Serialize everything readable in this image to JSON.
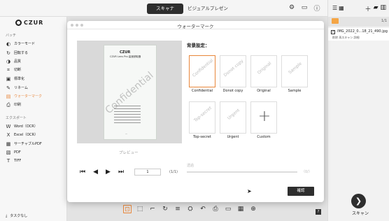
{
  "topbar": {
    "mode_tabs": [
      "スキャナ",
      "ビジュアルプレゼン"
    ],
    "icons": [
      "settings-icon",
      "feedback-icon",
      "help-icon"
    ]
  },
  "sidebar": {
    "brand": "CZUR",
    "batch_title": "バッチ",
    "batch_items": [
      {
        "label": "カラーモード",
        "icon": "color-mode-icon"
      },
      {
        "label": "回転する",
        "icon": "rotate-icon"
      },
      {
        "label": "品質",
        "icon": "quality-icon"
      },
      {
        "label": "切断",
        "icon": "cut-icon"
      },
      {
        "label": "標準化",
        "icon": "standardize-icon"
      },
      {
        "label": "リネーム",
        "icon": "rename-icon"
      },
      {
        "label": "ウォーターマーク",
        "icon": "watermark-icon",
        "active": true
      },
      {
        "label": "印刷",
        "icon": "print-icon"
      }
    ],
    "export_title": "エクスポート",
    "export_items": [
      {
        "label": "Word（OCR）",
        "icon": "word-icon"
      },
      {
        "label": "Excel（OCR）",
        "icon": "excel-icon"
      },
      {
        "label": "サーチャブルPDF",
        "icon": "searchable-pdf-icon"
      },
      {
        "label": "PDF",
        "icon": "pdf-icon"
      },
      {
        "label": "TIFF",
        "icon": "tiff-icon"
      }
    ],
    "bottom_label": "タスクなし"
  },
  "right_panel": {
    "count": "1/1",
    "file_name": "IMG_2022_0...18_21_490.jpg",
    "file_actions": "削除 再スキャン 詳細",
    "scan_label": "スキャン"
  },
  "dialog": {
    "title": "ウォーターマーク",
    "preview_label": "プレビュー",
    "preview_doc": {
      "brand": "CZUR",
      "title": "CZUR Lens Pro 高速読取器",
      "watermark": "Confidential"
    },
    "page_input": "1",
    "page_total": "(1/1)",
    "background_label": "背景設定：",
    "options": [
      {
        "label": "Confidential",
        "wm": "Confidential",
        "selected": true
      },
      {
        "label": "Donot copy",
        "wm": "Donot copy"
      },
      {
        "label": "Original",
        "wm": "Original"
      },
      {
        "label": "Sample",
        "wm": "Sample"
      },
      {
        "label": "Top-secret",
        "wm": "Top-secret"
      },
      {
        "label": "Urgent",
        "wm": "Urgent"
      },
      {
        "label": "Custom",
        "wm": "+"
      }
    ],
    "opacity_label": "透過",
    "opacity_value": "（0/）",
    "confirm_label": "確認"
  },
  "colors": {
    "accent": "#e8863a",
    "dark": "#2e2e2e"
  }
}
